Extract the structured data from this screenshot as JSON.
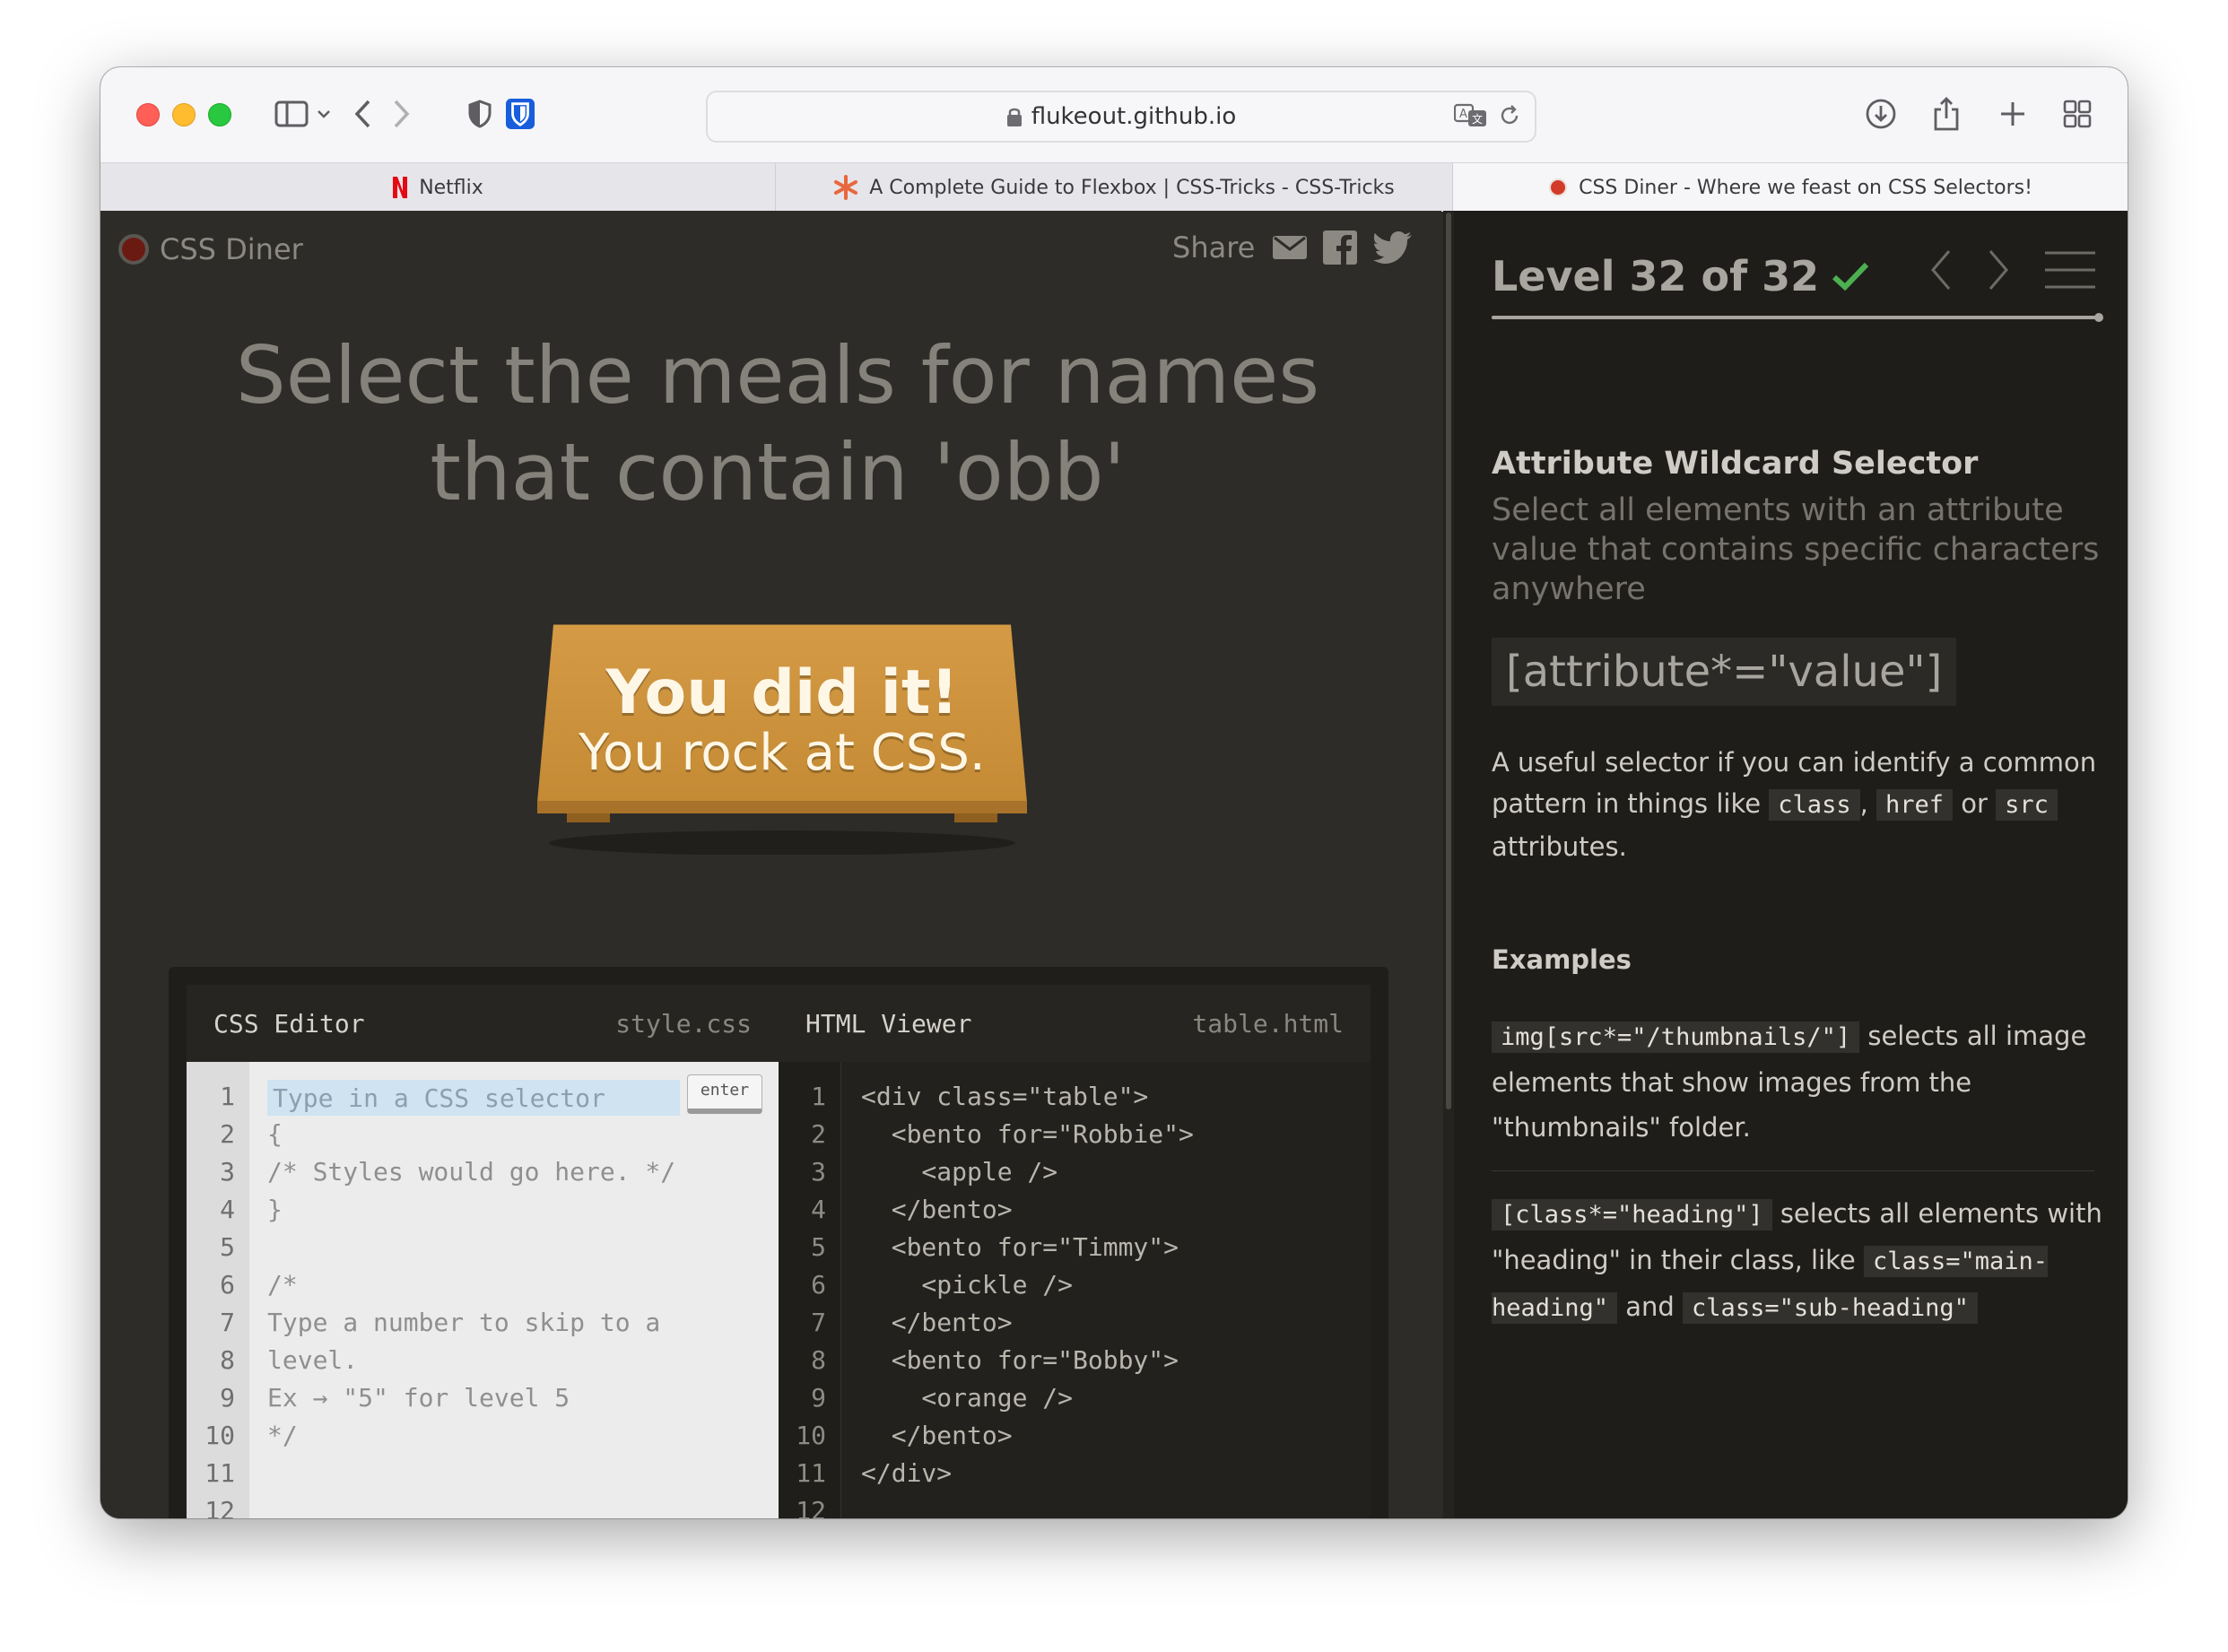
{
  "browser": {
    "url": "flukeout.github.io",
    "tabs": [
      {
        "label": "Netflix",
        "active": false
      },
      {
        "label": "A Complete Guide to Flexbox | CSS-Tricks - CSS-Tricks",
        "active": false
      },
      {
        "label": "CSS Diner - Where we feast on CSS Selectors!",
        "active": true
      }
    ]
  },
  "game": {
    "logo": "CSS Diner",
    "share_label": "Share",
    "instruction": "Select the meals for names that contain 'obb'",
    "win_line1": "You did it!",
    "win_line2": "You rock at CSS.",
    "table_color": "#c8903a"
  },
  "editor": {
    "css_title": "CSS Editor",
    "css_file": "style.css",
    "html_title": "HTML Viewer",
    "html_file": "table.html",
    "input_placeholder": "Type in a CSS selector",
    "enter_label": "enter",
    "line_numbers": [
      "1",
      "2",
      "3",
      "4",
      "5",
      "6",
      "7",
      "8",
      "9",
      "10",
      "11",
      "12"
    ],
    "css_lines": "\n{\n/* Styles would go here. */\n}\n\n/*\nType a number to skip to a\nlevel.\nEx → \"5\" for level 5\n*/\n",
    "html_lines": "<div class=\"table\">\n  <bento for=\"Robbie\">\n    <apple />\n  </bento>\n  <bento for=\"Timmy\">\n    <pickle />\n  </bento>\n  <bento for=\"Bobby\">\n    <orange />\n  </bento>\n</div>\n"
  },
  "sidebar": {
    "level_text": "Level 32 of 32",
    "completed": true,
    "progress": 1.0,
    "selector_name": "Attribute Wildcard Selector",
    "selector_desc": "Select all elements with an attribute value that contains specific characters anywhere",
    "syntax": "[attribute*=\"value\"]",
    "hint": {
      "before": "A useful selector if you can identify a common pattern in things like",
      "code1": "class",
      "comma": ",",
      "code2": "href",
      "or": "or",
      "code3": "src",
      "after": "attributes."
    },
    "examples_title": "Examples",
    "examples": [
      {
        "code": "img[src*=\"/thumbnails/\"]",
        "text": "selects all image elements that show images from the \"thumbnails\" folder."
      },
      {
        "code": "[class*=\"heading\"]",
        "text": "selects all elements with \"heading\" in their class, like",
        "code2": "class=\"main-heading\"",
        "and": "and",
        "code3": "class=\"sub-heading\""
      }
    ]
  },
  "colors": {
    "accent_green": "#4caf50",
    "netflix_red": "#e50914"
  }
}
